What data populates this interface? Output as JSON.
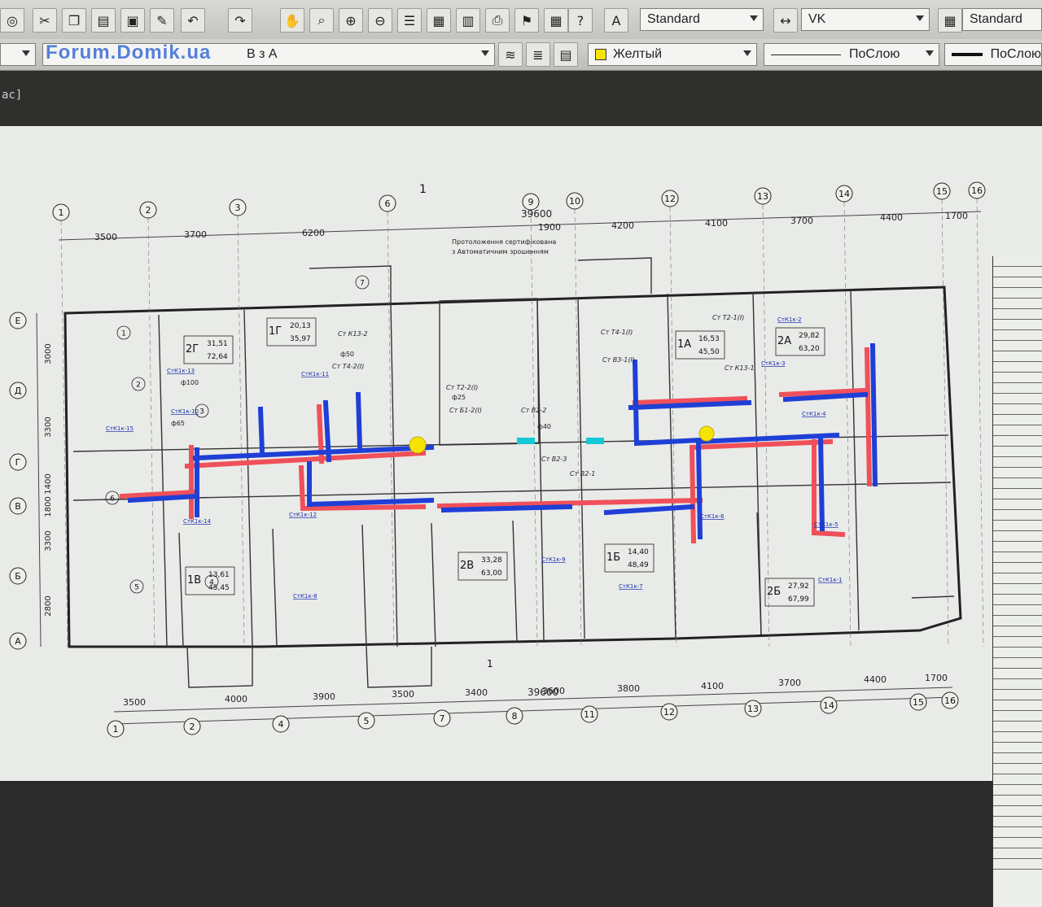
{
  "toolbar": {
    "text_style": "Standard",
    "dim_style": "VK",
    "table_style": "Standard",
    "layer_name": "В з А",
    "color": "Желтый",
    "linetype": "ПоСлою",
    "lineweight": "ПоСлою"
  },
  "command_line": {
    "text": "ас]"
  },
  "watermark": {
    "text": "Forum.Domik.ua"
  },
  "plan": {
    "section_marker": "1",
    "note_line1": "Протоложення сертифікована",
    "note_line2": "з Автоматичним зрошенням",
    "axes_numbers": [
      "1",
      "2",
      "3",
      "6",
      "9",
      "10",
      "12",
      "13",
      "14",
      "15",
      "16"
    ],
    "axes_numbers_bottom": [
      "1",
      "2",
      "4",
      "5",
      "7",
      "8",
      "11",
      "12",
      "13",
      "14",
      "15",
      "16"
    ],
    "axes_letters": [
      "Е",
      "Д",
      "Г",
      "В",
      "Б",
      "А"
    ],
    "dims_top": [
      "3500",
      "3700",
      "6200",
      "1900",
      "4200",
      "4100",
      "3700",
      "4400",
      "1700"
    ],
    "dim_total_top": "39600",
    "dims_bottom": [
      "3500",
      "4000",
      "3900",
      "3500",
      "3400",
      "3600",
      "3800",
      "4100",
      "3700",
      "4400",
      "1700"
    ],
    "dim_total_bottom": "39600",
    "dims_left": [
      "3000",
      "3300",
      "1400",
      "1800",
      "3300",
      "2800"
    ],
    "apartments": [
      {
        "code": "2Г",
        "a": "31,51",
        "b": "72,64"
      },
      {
        "code": "1Г",
        "a": "20,13",
        "b": "35,97"
      },
      {
        "code": "1А",
        "a": "16,53",
        "b": "45,50"
      },
      {
        "code": "2А",
        "a": "29,82",
        "b": "63,20"
      },
      {
        "code": "1В",
        "a": "13,61",
        "b": "45,45"
      },
      {
        "code": "2В",
        "a": "33,28",
        "b": "63,00"
      },
      {
        "code": "1Б",
        "a": "14,40",
        "b": "48,49"
      },
      {
        "code": "2Б",
        "a": "27,92",
        "b": "67,99"
      }
    ],
    "riser_labels": [
      "Ст К13-2",
      "Ст Т4-2(І)",
      "Ст Т2-2(І)",
      "Ст Б1-2(І)",
      "Ст В2-2",
      "Ст В2-3",
      "Ст В2-1",
      "Ст Т4-1(І)",
      "Ст В3-1(І)",
      "Ст Т2-1(І)",
      "Ст К13-1"
    ],
    "pipe_labels": [
      "СтК1к-13",
      "СтК1к-11",
      "СтК1к-10",
      "СтК1к-15",
      "СтК1к-14",
      "СтК1к-12",
      "СтК1к-8",
      "СтК1к-9",
      "СтК1к-7",
      "СтК1к-6",
      "СтК1к-5",
      "СтК1к-4",
      "СтК1к-3",
      "СтК1к-2",
      "СтК1к-1"
    ],
    "diameters": [
      "ф100",
      "ф50",
      "ф25",
      "ф40",
      "ф65"
    ],
    "room_numbers": [
      "1",
      "2",
      "3",
      "4",
      "5",
      "6",
      "7"
    ]
  },
  "colors": {
    "pipe_blue": "#1f3fd6",
    "pipe_red": "#f0505a",
    "accent_yellow": "#f5e400",
    "cyan": "#14c8d8"
  }
}
